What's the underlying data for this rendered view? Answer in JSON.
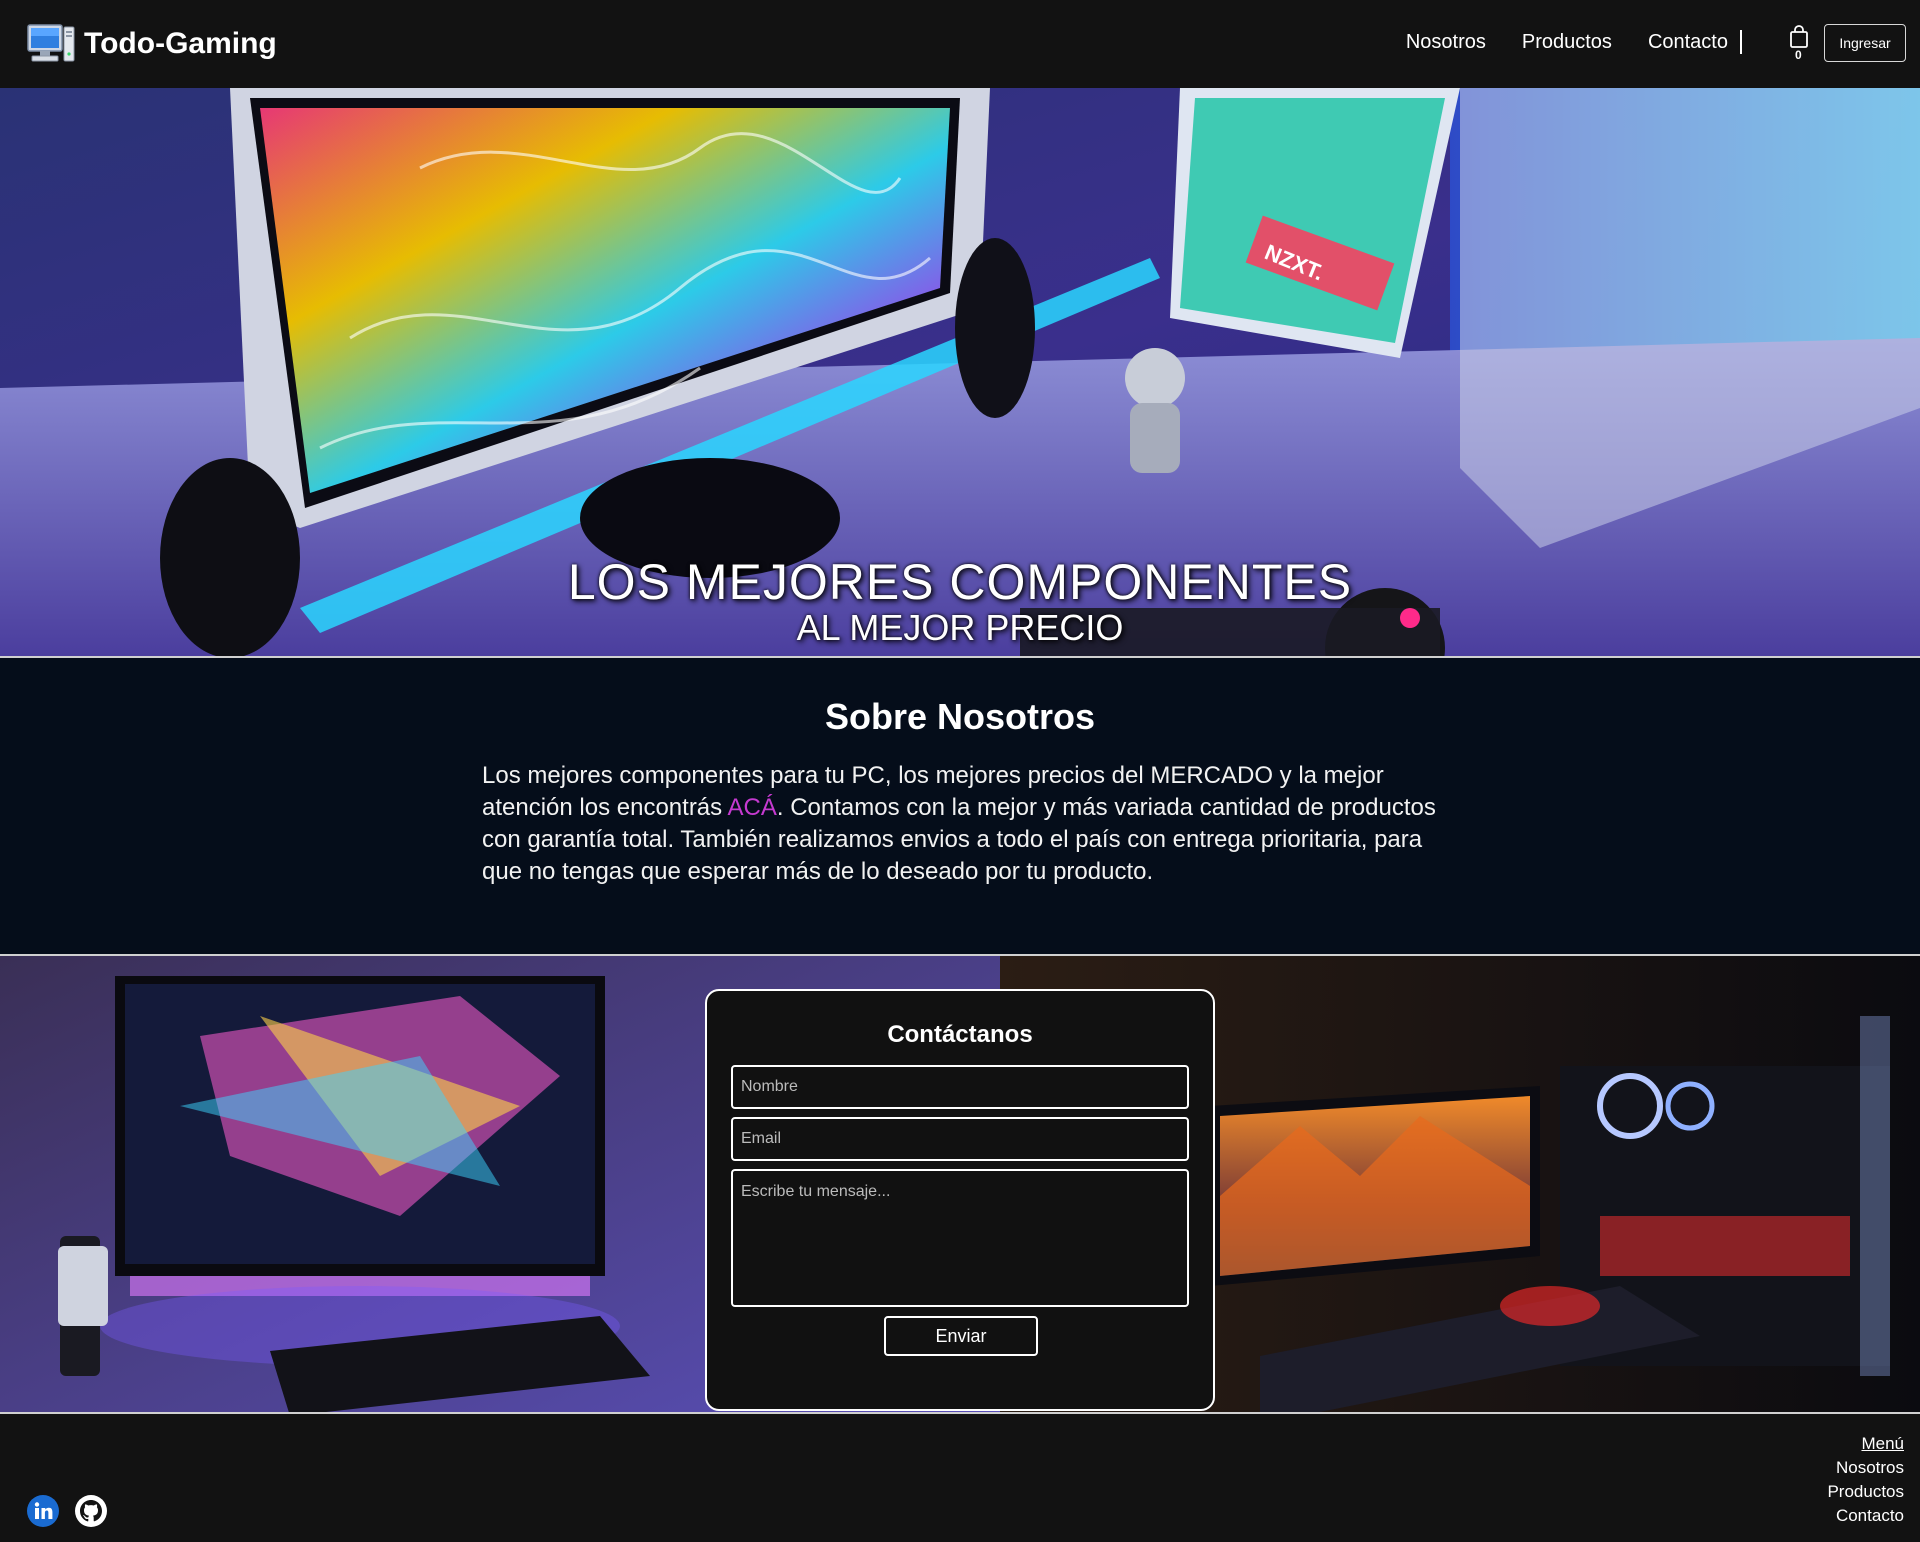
{
  "header": {
    "brand": "Todo-Gaming",
    "nav": [
      "Nosotros",
      "Productos",
      "Contacto"
    ],
    "cart_count": "0",
    "login_label": "Ingresar"
  },
  "hero": {
    "title": "LOS MEJORES COMPONENTES",
    "subtitle": "AL MEJOR PRECIO",
    "case_brand": "NZXT."
  },
  "about": {
    "title": "Sobre Nosotros",
    "text_before": "Los mejores componentes para tu PC, los mejores precios del MERCADO y la mejor atención los encontrás ",
    "link": "ACÁ",
    "text_after": ". Contamos con la mejor y más variada cantidad de productos con garantía total. También realizamos envios a todo el país con entrega prioritaria, para que no tengas que esperar más de lo deseado por tu producto."
  },
  "contact": {
    "title": "Contáctanos",
    "name_placeholder": "Nombre",
    "email_placeholder": "Email",
    "message_placeholder": "Escribe tu mensaje...",
    "submit": "Enviar"
  },
  "footer": {
    "menu_title": "Menú",
    "links": [
      "Nosotros",
      "Productos",
      "Contacto"
    ],
    "social": [
      "linkedin-icon",
      "github-icon"
    ]
  },
  "colors": {
    "accent": "#c53ad0",
    "header_bg": "#121212",
    "about_bg": "#050d1a"
  }
}
